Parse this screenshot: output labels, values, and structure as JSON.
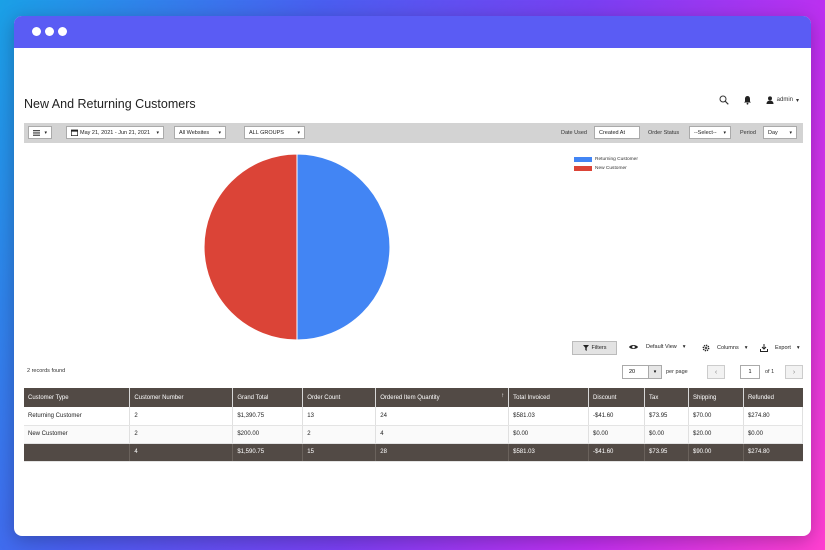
{
  "page": {
    "title": "New And Returning Customers"
  },
  "header": {
    "user": "admin"
  },
  "toolbar": {
    "date_range": "May 21, 2021 - Jun 21, 2021",
    "website": "All Websites",
    "group": "ALL GROUPS",
    "date_used_label": "Date Used",
    "date_used_value": "Created At",
    "order_status_label": "Order Status",
    "order_status_value": "--Select--",
    "period_label": "Period",
    "period_value": "Day"
  },
  "chart_data": {
    "type": "pie",
    "categories": [
      "Returning Customer",
      "New Customer"
    ],
    "values": [
      50,
      50
    ],
    "colors": [
      "#4285f4",
      "#db4437"
    ],
    "legend_position": "top-right"
  },
  "grid_controls": {
    "filters": "Filters",
    "view": "Default View",
    "columns": "Columns",
    "export": "Export",
    "records_found": "2 records found",
    "per_page_value": "20",
    "per_page_label": "per page",
    "current_page": "1",
    "of_pages": "of 1"
  },
  "table": {
    "headers": [
      "Customer Type",
      "Customer Number",
      "Grand Total",
      "Order Count",
      "Ordered Item Quantity",
      "Total Invoiced",
      "Discount",
      "Tax",
      "Shipping",
      "Refunded"
    ],
    "rows": [
      [
        "Returning Customer",
        "2",
        "$1,390.75",
        "13",
        "24",
        "$581.03",
        "-$41.60",
        "$73.95",
        "$70.00",
        "$274.80"
      ],
      [
        "New Customer",
        "2",
        "$200.00",
        "2",
        "4",
        "$0.00",
        "$0.00",
        "$0.00",
        "$20.00",
        "$0.00"
      ]
    ],
    "totals": [
      "",
      "4",
      "$1,590.75",
      "15",
      "28",
      "$581.03",
      "-$41.60",
      "$73.95",
      "$90.00",
      "$274.80"
    ]
  }
}
